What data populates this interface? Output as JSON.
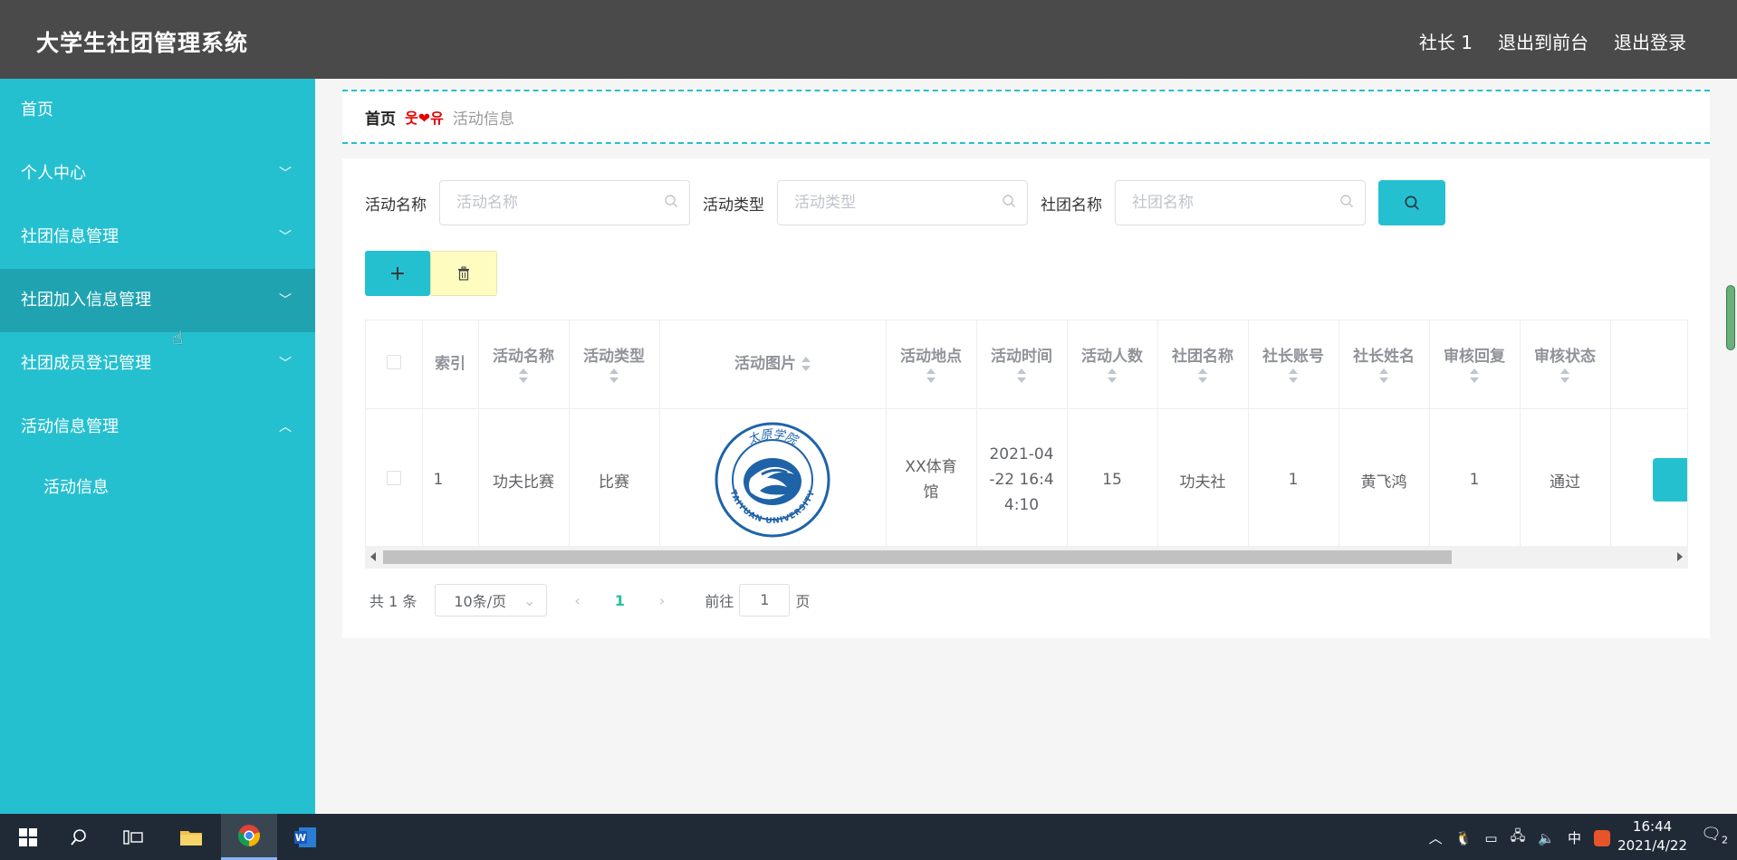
{
  "header": {
    "title": "大学生社团管理系统",
    "user": "社长 1",
    "front_link": "退出到前台",
    "logout": "退出登录"
  },
  "sidebar": {
    "items": [
      {
        "label": "首页",
        "chev": ""
      },
      {
        "label": "个人中心",
        "chev": "﹀"
      },
      {
        "label": "社团信息管理",
        "chev": "﹀"
      },
      {
        "label": "社团加入信息管理",
        "chev": "﹀"
      },
      {
        "label": "社团成员登记管理",
        "chev": "﹀"
      },
      {
        "label": "活动信息管理",
        "chev": "︿"
      }
    ],
    "sub_items": [
      {
        "label": "活动信息"
      }
    ]
  },
  "breadcrumb": {
    "home": "首页",
    "sep": "웃❤유",
    "current": "活动信息"
  },
  "search": {
    "f1_label": "活动名称",
    "f1_placeholder": "活动名称",
    "f2_label": "活动类型",
    "f2_placeholder": "活动类型",
    "f3_label": "社团名称",
    "f3_placeholder": "社团名称"
  },
  "actions": {
    "add": "+"
  },
  "table": {
    "headers": [
      "索引",
      "活动名称",
      "活动类型",
      "活动图片",
      "活动地点",
      "活动时间",
      "活动人数",
      "社团名称",
      "社长账号",
      "社长姓名",
      "审核回复",
      "审核状态"
    ],
    "rows": [
      {
        "index": "1",
        "name": "功夫比赛",
        "type": "比赛",
        "image_text_top": "太原学院",
        "image_text_bottom": "TAIYUAN UNIVERSITY",
        "place": "XX体育馆",
        "time": "2021-04-22 16:44:10",
        "count": "15",
        "club": "功夫社",
        "leader_account": "1",
        "leader_name": "黄飞鸿",
        "reply": "1",
        "status": "通过"
      }
    ]
  },
  "pager": {
    "total": "共 1 条",
    "page_size": "10条/页",
    "prev": "‹",
    "current": "1",
    "next": "›",
    "goto_label": "前往",
    "goto_value": "1",
    "page_suffix": "页"
  },
  "taskbar": {
    "ime": "中",
    "time": "16:44",
    "date": "2021/4/22",
    "notify_count": "2"
  },
  "colors": {
    "accent": "#25c0d0",
    "header": "#4a4a4a",
    "sidebar_active": "#1fa3b1"
  }
}
